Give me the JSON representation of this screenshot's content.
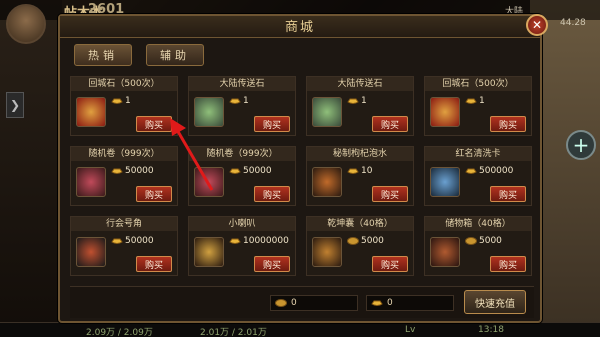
{
  "hud": {
    "player_name": "帖木本",
    "power": "2601",
    "region_label": "大陆",
    "region_value": "44.28",
    "bottom_hp": "2.09万 / 2.09万",
    "bottom_mp": "2.01万 / 2.01万",
    "bottom_level": "Lv",
    "bottom_time": "13:18"
  },
  "shop": {
    "title": "商城",
    "tabs": [
      {
        "label": "热销",
        "active": true
      },
      {
        "label": "辅助",
        "active": false
      }
    ],
    "items": [
      {
        "name": "回城石（500次）",
        "price": "1",
        "currency": "gold-ingot",
        "buy_label": "购买",
        "icon": "return-stone-icon"
      },
      {
        "name": "大陆传送石",
        "price": "1",
        "currency": "gold-ingot",
        "buy_label": "购买",
        "icon": "teleport-stone-icon"
      },
      {
        "name": "大陆传送石",
        "price": "1",
        "currency": "gold-ingot",
        "buy_label": "购买",
        "icon": "teleport-stone-icon"
      },
      {
        "name": "回城石（500次）",
        "price": "1",
        "currency": "gold-ingot",
        "buy_label": "购买",
        "icon": "return-stone-icon"
      },
      {
        "name": "随机卷（999次）",
        "price": "50000",
        "currency": "gold-ingot",
        "buy_label": "购买",
        "icon": "random-scroll-icon"
      },
      {
        "name": "随机卷（999次）",
        "price": "50000",
        "currency": "gold-ingot",
        "buy_label": "购买",
        "icon": "random-scroll-icon"
      },
      {
        "name": "秘制枸杞泡水",
        "price": "10",
        "currency": "gold-ingot",
        "buy_label": "购买",
        "icon": "potion-icon"
      },
      {
        "name": "红名清洗卡",
        "price": "500000",
        "currency": "gold-ingot",
        "buy_label": "购买",
        "icon": "cleanse-card-icon"
      },
      {
        "name": "行会号角",
        "price": "50000",
        "currency": "gold-ingot",
        "buy_label": "购买",
        "icon": "guild-horn-icon"
      },
      {
        "name": "小喇叭",
        "price": "10000000",
        "currency": "gold-ingot",
        "buy_label": "购买",
        "icon": "megaphone-icon"
      },
      {
        "name": "乾坤囊（40格）",
        "price": "5000",
        "currency": "gold-coin",
        "buy_label": "购买",
        "icon": "bag-icon"
      },
      {
        "name": "储物箱（40格）",
        "price": "5000",
        "currency": "gold-coin",
        "buy_label": "购买",
        "icon": "storage-chest-icon"
      }
    ],
    "balance_coin": "0",
    "balance_ingot": "0",
    "recharge_label": "快速充值"
  },
  "colors": {
    "panel_border": "#6e5532",
    "buy_button": "#b1321f",
    "arrow": "#e01a1a"
  }
}
